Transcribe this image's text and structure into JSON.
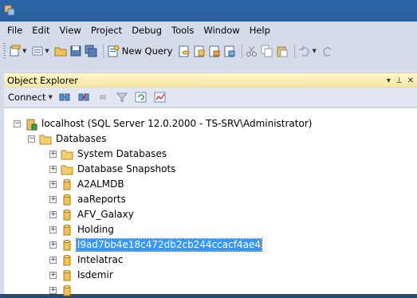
{
  "menu": {
    "items": [
      "File",
      "Edit",
      "View",
      "Project",
      "Debug",
      "Tools",
      "Window",
      "Help"
    ]
  },
  "toolbar": {
    "new_query_label": "New Query"
  },
  "object_explorer": {
    "title": "Object Explorer",
    "pin_glyph": "▾ ⊥ ✕",
    "connect_label": "Connect",
    "tree": {
      "server": "localhost (SQL Server 12.0.2000 - TS-SRV\\Administrator)",
      "databases_folder": "Databases",
      "items": [
        {
          "label": "System Databases",
          "type": "folder"
        },
        {
          "label": "Database Snapshots",
          "type": "folder"
        },
        {
          "label": "A2ALMDB",
          "type": "database"
        },
        {
          "label": "aaReports",
          "type": "database"
        },
        {
          "label": "AFV_Galaxy",
          "type": "database"
        },
        {
          "label": "Holding",
          "type": "database"
        },
        {
          "label": "l9ad7bb4e18c472db2cb244ccacf4ae4",
          "type": "database",
          "selected": true
        },
        {
          "label": "Intelatrac",
          "type": "database"
        },
        {
          "label": "Isdemir",
          "type": "database"
        }
      ]
    }
  },
  "colors": {
    "titlebar": "#2d66a8",
    "chrome": "#d6dbe9",
    "panel_header": "#f5e7a1",
    "selection": "#3399ff"
  }
}
